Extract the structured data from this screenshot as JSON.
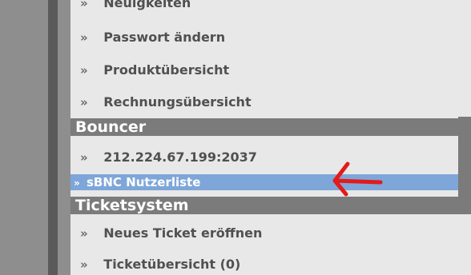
{
  "menu": {
    "items_top": [
      {
        "label": "Neuigkeiten"
      },
      {
        "label": "Passwort ändern"
      },
      {
        "label": "Produktübersicht"
      },
      {
        "label": "Rechnungsübersicht"
      }
    ],
    "bouncer_header": "Bouncer",
    "bouncer_items": [
      {
        "label": "212.224.67.199:2037"
      }
    ],
    "active_item": {
      "label": "sBNC Nutzerliste"
    },
    "ticket_header": "Ticketsystem",
    "ticket_items": [
      {
        "label": "Neues Ticket eröffnen"
      },
      {
        "label": "Ticketübersicht (0)"
      }
    ],
    "bullet": "»"
  },
  "annotation": {
    "arrow_color": "#e21b1b"
  },
  "colors": {
    "active_bg": "#7ea6d8",
    "header_bg": "#7b7b7b",
    "menu_bg": "#e8e8e8"
  }
}
